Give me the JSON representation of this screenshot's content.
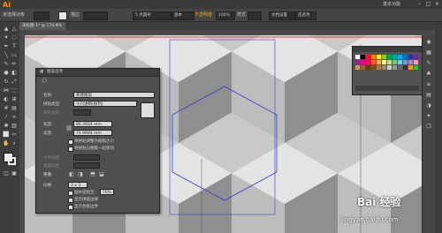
{
  "app": {
    "logo": "Ai",
    "workspace": "基本功能"
  },
  "window_buttons": [
    "–",
    "□",
    "×"
  ],
  "control": {
    "selection_label": "未选择对象",
    "stroke_label": "描边",
    "opacity_label": "不透明度",
    "opacity_value": "100%",
    "style_label": "样式",
    "doc_setup": "文档设置",
    "prefs": "首选项",
    "basic_label": "5 点圆形",
    "profile": "基本"
  },
  "doc_tab": {
    "label": "未标题-1* @ 174.9% (CMYK/预览)"
  },
  "dialog": {
    "title": "图案选项",
    "name_label": "名称:",
    "name_value": "新建图案",
    "tile_type_label": "拼贴类型:",
    "tile_type_value": "十六进制(按列)",
    "brick_offset_label": "砖形位移:",
    "width_label": "宽度:",
    "width_value": "86.3924 mm",
    "height_label": "高度:",
    "height_value": "74.9994 mm",
    "opt1": "将拼贴调整为图稿大小",
    "opt2": "将拼贴与图稿一起移动",
    "h_spacing_label": "水平间距:",
    "v_spacing_label": "垂直间距:",
    "overlap_label": "重叠:",
    "copies_label": "份数:",
    "copies_value": "3 x 3",
    "dim_copies_label": "副本变暗至:",
    "dim_copies_value": "70%",
    "show_tile_edge": "显示拼贴边缘",
    "show_swatch_bounds": "显示色板边界"
  },
  "watermark": {
    "title": "Bai 经验",
    "url": "jingyan.baidu.com"
  },
  "colors": {
    "accent_orange": "#ff8a00",
    "guide_red": "#d83a3a",
    "tile_edge_blue": "#3b3bd0",
    "hex_light": "#e4e4e4",
    "hex_mid": "#c9c9c9",
    "hex_dark": "#8f8f8f",
    "swatch_palette": [
      "#ffffff",
      "#000000",
      "#ed1c24",
      "#ff7f00",
      "#fff200",
      "#8dc63f",
      "#00a651",
      "#00a99d",
      "#00aeef",
      "#0072bc",
      "#2e3192",
      "#662d91",
      "#92278f",
      "#ec008c",
      "#ed145b",
      "#f26522",
      "#fbaf5d",
      "#fff799",
      "#c4df9b",
      "#7cc576",
      "#6dcff6",
      "#8493ca",
      "#a186be",
      "#f49ac1",
      "#c69c6d",
      "#8c6239",
      "#603913",
      "#754c24",
      "#a67c52",
      "#998675",
      "#cccccc",
      "#999999",
      "#666666",
      "#333333",
      "#f7941d",
      "#39b54a"
    ]
  }
}
